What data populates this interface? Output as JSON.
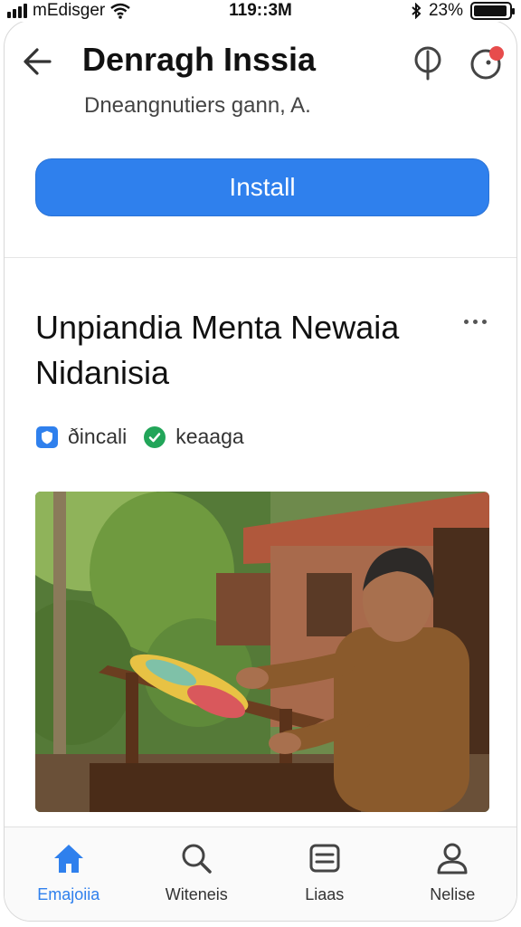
{
  "status_bar": {
    "carrier": "mEdisger",
    "time": "119::3M",
    "battery_text": "23%",
    "battery_level": 0.95
  },
  "header": {
    "title": "Denragh Inssia",
    "subtitle": "Dneangnutiers gann, A.",
    "install_label": "Install"
  },
  "article": {
    "title": "Unpiandia Menta Newaia Nidanisia",
    "tags": [
      {
        "label": "ðincali",
        "icon": "shield-icon"
      },
      {
        "label": "keaaga",
        "icon": "check-circle-icon"
      }
    ],
    "image_icon": "photo"
  },
  "nav": {
    "items": [
      {
        "label": "Emajoiia",
        "icon": "home-icon",
        "active": true
      },
      {
        "label": "Witeneis",
        "icon": "search-icon",
        "active": false
      },
      {
        "label": "Liaas",
        "icon": "list-icon",
        "active": false
      },
      {
        "label": "Nelise",
        "icon": "person-icon",
        "active": false
      }
    ]
  },
  "colors": {
    "accent": "#2f80ed",
    "notification": "#e74c4c",
    "tag_green": "#22a559"
  }
}
